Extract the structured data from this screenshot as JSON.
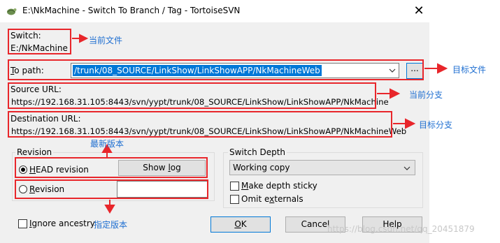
{
  "window": {
    "title": "E:\\NkMachine - Switch To Branch / Tag - TortoiseSVN",
    "close_glyph": "✕"
  },
  "switch": {
    "label": "Switch:",
    "value": "E:/NkMachine"
  },
  "to_path": {
    "label_underline": "T",
    "label_rest": "o path:",
    "value": "/trunk/08_SOURCE/LinkShow/LinkShowAPP/NkMachineWeb",
    "browse_label": "..."
  },
  "source_url": {
    "label": "Source URL:",
    "value": "https://192.168.31.105:8443/svn/yypt/trunk/08_SOURCE/LinkShow/LinkShowAPP/NkMachine"
  },
  "destination_url": {
    "label": "Destination URL:",
    "value": "https://192.168.31.105:8443/svn/yypt/trunk/08_SOURCE/LinkShow/LinkShowAPP/NkMachineWeb"
  },
  "revision": {
    "group_title": "Revision",
    "head_underline": "H",
    "head_rest": "EAD revision",
    "head_selected": true,
    "show_log_pre": "Show ",
    "show_log_underline": "l",
    "show_log_post": "og",
    "revision_underline": "R",
    "revision_rest": "evision",
    "revision_value": ""
  },
  "switch_depth": {
    "group_title": "Switch Depth",
    "selected": "Working copy",
    "make_sticky_underline": "M",
    "make_sticky_rest": "ake depth sticky",
    "omit_pre": "Omit e",
    "omit_underline": "x",
    "omit_post": "ternals"
  },
  "ignore_ancestry": {
    "underline": "I",
    "rest": "gnore ancestry"
  },
  "buttons": {
    "ok_underline": "O",
    "ok_rest": "K",
    "cancel": "Cancel",
    "help": "Help"
  },
  "annotations": {
    "current_file": "当前文件",
    "target_file": "目标文件",
    "current_branch": "当前分支",
    "target_branch": "目标分支",
    "latest_version": "最新版本",
    "specified_version": "指定版本"
  },
  "colors": {
    "annotation_red": "#e8262b",
    "annotation_text_blue": "#1f6fd1",
    "selection_blue": "#0078d7"
  },
  "watermark": "https://blog.csdn.net/qq_20451879"
}
